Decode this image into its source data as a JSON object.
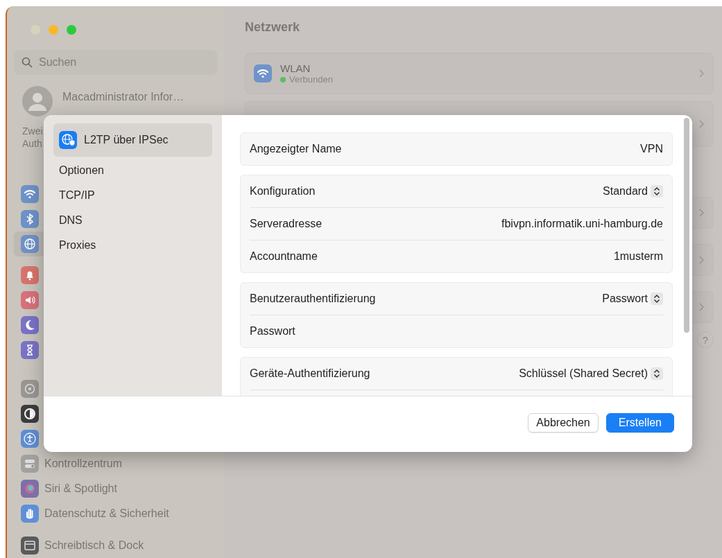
{
  "window": {
    "title": "Netzwerk",
    "traffic_lights": [
      {
        "color": "#d6d3bd"
      },
      {
        "color": "#f9b927"
      },
      {
        "color": "#2dc93c"
      }
    ]
  },
  "sidebar": {
    "search": {
      "placeholder": "Suchen"
    },
    "account": {
      "name": "Macadministrator Infor…"
    },
    "notice": [
      "Zwei",
      "Auth"
    ],
    "items": [
      {
        "kind": "wifi"
      },
      {
        "kind": "bluetooth"
      },
      {
        "kind": "network",
        "selected": true
      },
      {
        "kind": "notifications",
        "selected": false
      },
      {
        "kind": "sound",
        "selected": false
      },
      {
        "kind": "focus",
        "selected": false
      },
      {
        "kind": "screentime",
        "selected": false
      },
      {
        "kind": "general",
        "selected": false
      },
      {
        "kind": "appearance",
        "selected": false
      },
      {
        "kind": "accessibility",
        "selected": false
      },
      {
        "kind": "control",
        "label": "Kontrollzentrum",
        "selected": false
      },
      {
        "kind": "siri",
        "label": "Siri & Spotlight",
        "selected": false
      },
      {
        "kind": "privacy",
        "label": "Datenschutz & Sicherheit",
        "selected": false
      },
      {
        "kind": "desktop",
        "label": "Schreibtisch & Dock",
        "selected": false
      }
    ]
  },
  "services": [
    {
      "name": "WLAN",
      "status": "Verbunden",
      "color": "#5cbf5c"
    }
  ],
  "sheet": {
    "tabs": [
      {
        "label": "L2TP über IPSec",
        "selected": true
      },
      {
        "label": "Optionen",
        "selected": false
      },
      {
        "label": "TCP/IP",
        "selected": false
      },
      {
        "label": "DNS",
        "selected": false
      },
      {
        "label": "Proxies",
        "selected": false
      }
    ],
    "groups": [
      [
        {
          "label": "Angezeigter Name",
          "kind": "value",
          "value": "VPN"
        }
      ],
      [
        {
          "label": "Konfiguration",
          "kind": "popup",
          "value": "Standard"
        },
        {
          "label": "Serveradresse",
          "kind": "value",
          "value": "fbivpn.informatik.uni-hamburg.de"
        },
        {
          "label": "Accountname",
          "kind": "value",
          "value": "1musterm"
        }
      ],
      [
        {
          "label": "Benutzerauthentifizierung",
          "kind": "popup",
          "value": "Passwort"
        },
        {
          "label": "Passwort",
          "kind": "field"
        }
      ],
      [
        {
          "label": "Geräte-Authentifizierung",
          "kind": "popup",
          "value": "Schlüssel (Shared Secret)"
        },
        {
          "kind": "field"
        }
      ]
    ],
    "buttons": [
      {
        "label": "Abbrechen",
        "kind": "secondary"
      },
      {
        "label": "Erstellen",
        "kind": "primary"
      }
    ]
  },
  "help": {
    "label": "?"
  }
}
